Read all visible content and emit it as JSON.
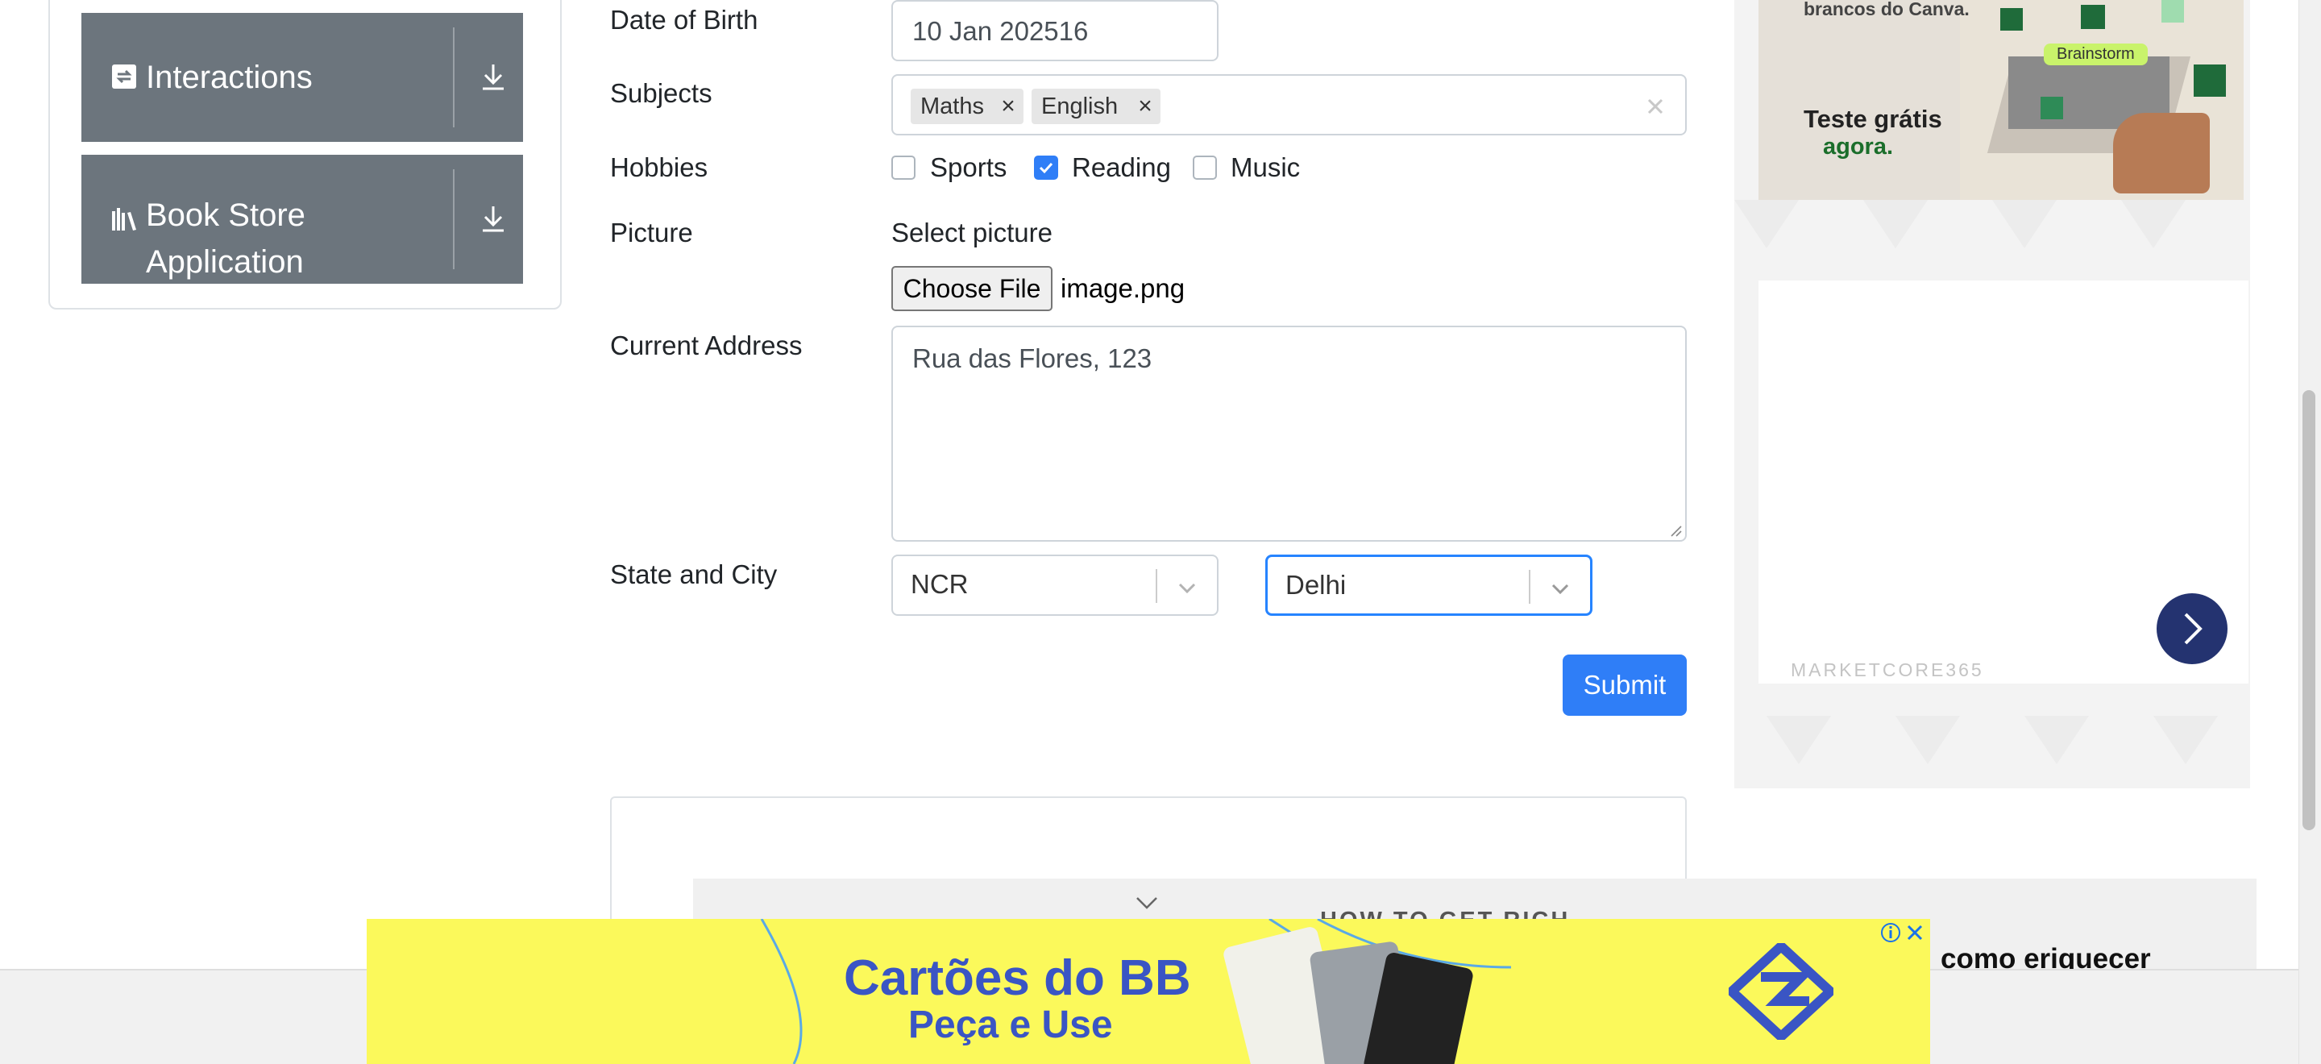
{
  "sidebar": {
    "groups": [
      {
        "label": "Interactions",
        "icon": "interactions-icon"
      },
      {
        "label": "Book Store",
        "label2": "Application",
        "icon": "books-icon"
      }
    ]
  },
  "form": {
    "dob": {
      "label": "Date of Birth",
      "value": "10 Jan 202516"
    },
    "subjects": {
      "label": "Subjects",
      "chips": [
        "Maths",
        "English"
      ]
    },
    "hobbies": {
      "label": "Hobbies",
      "options": [
        {
          "label": "Sports",
          "checked": false
        },
        {
          "label": "Reading",
          "checked": true
        },
        {
          "label": "Music",
          "checked": false
        }
      ]
    },
    "picture": {
      "label": "Picture",
      "select_label": "Select picture",
      "button": "Choose File",
      "file": "image.png"
    },
    "address": {
      "label": "Current Address",
      "value": "Rua das Flores, 123"
    },
    "state_city": {
      "label": "State and City",
      "state": "NCR",
      "city": "Delhi"
    },
    "submit": "Submit"
  },
  "ads": {
    "right": {
      "line1": "brancos do Canva.",
      "badge": "Brainstorm",
      "cta1": "Teste grátis",
      "cta2": "agora.",
      "brand": "MARKETCORE365"
    },
    "article": {
      "heading": "HOW TO GET RICH",
      "title_fragment": "como eriquecer"
    },
    "banner": {
      "line1": "Cartões do BB",
      "line2": "Peça e Use"
    }
  },
  "colors": {
    "sidebar_group": "#6c757d",
    "primary": "#2f7ef7",
    "banner_bg": "#fbf95b",
    "banner_text": "#3a55c4",
    "ad_badge": "#c9f36b",
    "next_button": "#243370"
  }
}
